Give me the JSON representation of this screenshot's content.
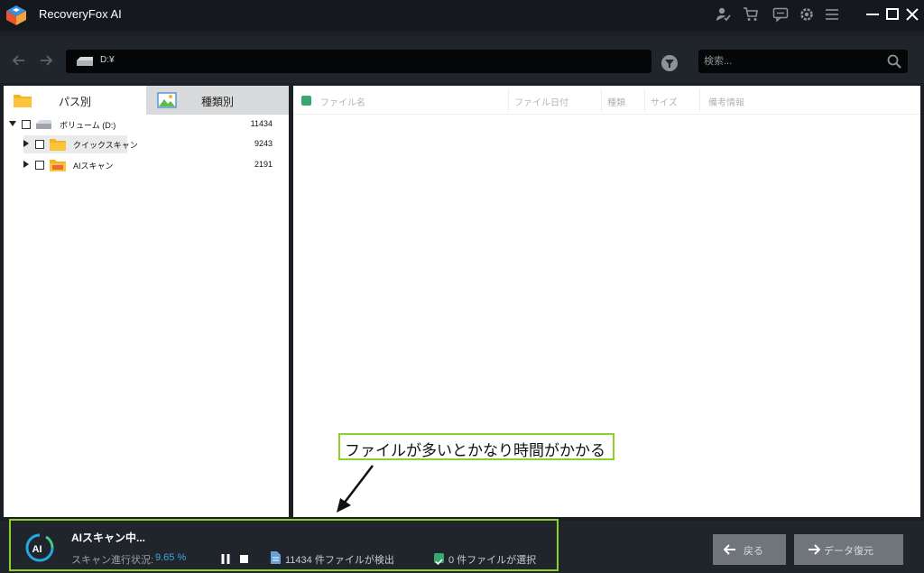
{
  "app": {
    "title": "RecoveryFox AI"
  },
  "toolbar": {
    "icons": [
      "user-check-icon",
      "cart-icon",
      "chat-icon",
      "gear-icon",
      "menu-icon"
    ],
    "window_controls": [
      "minimize-icon",
      "maximize-icon",
      "close-icon"
    ]
  },
  "address": {
    "path": "D:¥"
  },
  "search": {
    "placeholder": "検索..."
  },
  "left_tabs": [
    {
      "label": "パス別",
      "icon": "folder-icon"
    },
    {
      "label": "種類別",
      "icon": "image-icon"
    }
  ],
  "tree": [
    {
      "label": "ボリューム (D:)",
      "count": "11434",
      "icon": "drive-icon",
      "expanded": true
    },
    {
      "label": "クイックスキャン",
      "count": "9243",
      "icon": "folder-icon",
      "expanded": false
    },
    {
      "label": "AIスキャン",
      "count": "2191",
      "icon": "folder-icon",
      "expanded": false
    }
  ],
  "columns": [
    "ファイル名",
    "ファイル日付",
    "種類",
    "サイズ",
    "備考情報"
  ],
  "annotation": {
    "text": "ファイルが多いとかなり時間がかかる"
  },
  "status": {
    "title": "AIスキャン中...",
    "progress_label": "スキャン進行状況:",
    "progress_value": "9.65 %",
    "progress_percent": 9.65,
    "found_count": "11434",
    "found_suffix": "件ファイルが検出",
    "selected_count": "0",
    "selected_suffix": "件ファイルが選択"
  },
  "buttons": {
    "back": "戻る",
    "recover": "データ復元"
  },
  "colors": {
    "accent_green": "#3aa76d",
    "highlight": "#8bd12b",
    "progress_blue": "#3ea7e8"
  }
}
